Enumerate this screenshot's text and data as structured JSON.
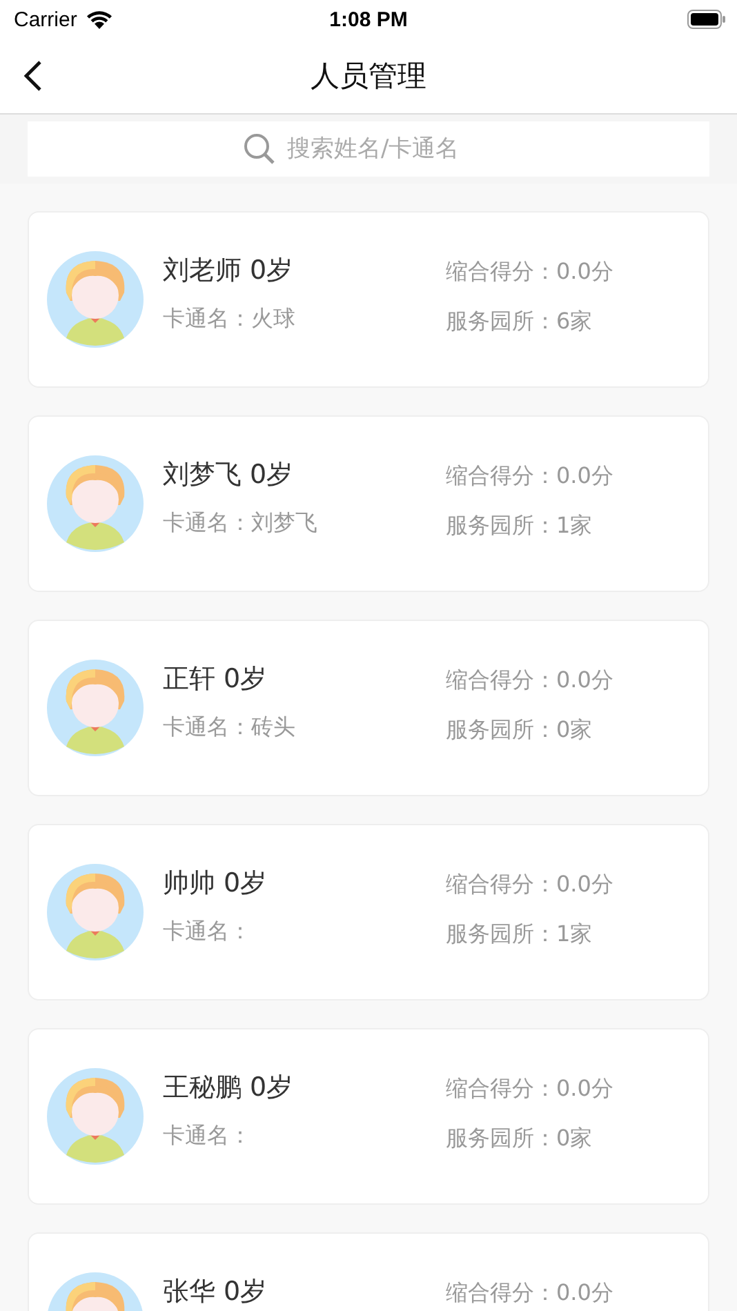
{
  "status_bar": {
    "carrier": "Carrier",
    "time": "1:08 PM"
  },
  "nav": {
    "title": "人员管理"
  },
  "search": {
    "placeholder": "搜索姓名/卡通名"
  },
  "people": [
    {
      "title": "刘老师 0岁",
      "cartoon": "卡通名：火球",
      "score": "缩合得分：0.0分",
      "services": "服务园所：6家"
    },
    {
      "title": "刘梦飞 0岁",
      "cartoon": "卡通名：刘梦飞",
      "score": "缩合得分：0.0分",
      "services": "服务园所：1家"
    },
    {
      "title": "正轩 0岁",
      "cartoon": "卡通名：砖头",
      "score": "缩合得分：0.0分",
      "services": "服务园所：0家"
    },
    {
      "title": "帅帅 0岁",
      "cartoon": "卡通名：",
      "score": "缩合得分：0.0分",
      "services": "服务园所：1家"
    },
    {
      "title": "王秘鹏 0岁",
      "cartoon": "卡通名：",
      "score": "缩合得分：0.0分",
      "services": "服务园所：0家"
    },
    {
      "title": "张华 0岁",
      "score": "缩合得分：0.0分"
    }
  ]
}
